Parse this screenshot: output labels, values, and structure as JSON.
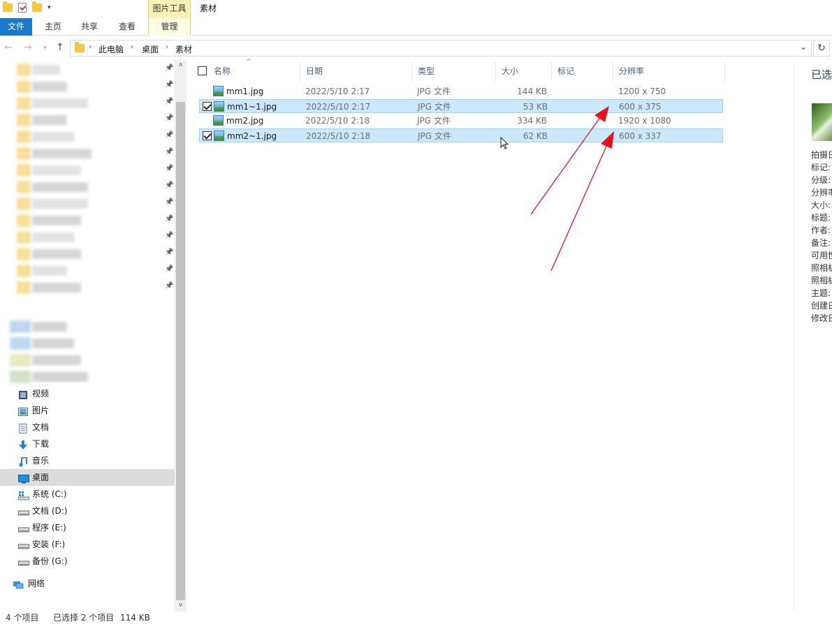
{
  "titlebar": {
    "context_group": "图片工具",
    "window_title": "素材"
  },
  "ribbon": {
    "tabs": [
      "文件",
      "主页",
      "共享",
      "查看",
      "管理"
    ]
  },
  "address": {
    "crumbs": [
      "此电脑",
      "桌面",
      "素材"
    ]
  },
  "nav": {
    "libraries": [
      {
        "label": "视频",
        "icon": "video-icon"
      },
      {
        "label": "图片",
        "icon": "picture-icon"
      },
      {
        "label": "文档",
        "icon": "document-icon"
      },
      {
        "label": "下载",
        "icon": "download-icon"
      },
      {
        "label": "音乐",
        "icon": "music-icon"
      },
      {
        "label": "桌面",
        "icon": "desktop-icon"
      }
    ],
    "drives": [
      {
        "label": "系统 (C:)",
        "icon": "windows-drive-icon"
      },
      {
        "label": "文档 (D:)",
        "icon": "drive-icon"
      },
      {
        "label": "程序 (E:)",
        "icon": "drive-icon"
      },
      {
        "label": "安装 (F:)",
        "icon": "drive-icon"
      },
      {
        "label": "备份 (G:)",
        "icon": "drive-icon"
      }
    ],
    "network": "网络"
  },
  "columns": {
    "name": "名称",
    "date": "日期",
    "type": "类型",
    "size": "大小",
    "tags": "标记",
    "resolution": "分辨率"
  },
  "files": [
    {
      "name": "mm1.jpg",
      "date": "2022/5/10 2:17",
      "type": "JPG 文件",
      "size": "144 KB",
      "resolution": "1200 x 750",
      "selected": false
    },
    {
      "name": "mm1~1.jpg",
      "date": "2022/5/10 2:17",
      "type": "JPG 文件",
      "size": "53 KB",
      "resolution": "600 x 375",
      "selected": true
    },
    {
      "name": "mm2.jpg",
      "date": "2022/5/10 2:18",
      "type": "JPG 文件",
      "size": "334 KB",
      "resolution": "1920 x 1080",
      "selected": false
    },
    {
      "name": "mm2~1.jpg",
      "date": "2022/5/10 2:18",
      "type": "JPG 文件",
      "size": "62 KB",
      "resolution": "600 x 337",
      "selected": true
    }
  ],
  "details": {
    "title": "已选",
    "labels": [
      "拍摄日",
      "标记:",
      "分级:",
      "分辨率",
      "大小:",
      "标题:",
      "作者:",
      "备注:",
      "可用性",
      "照相机",
      "照相机",
      "主题:",
      "创建日",
      "修改日"
    ]
  },
  "status": {
    "count": "4 个项目",
    "selection": "已选择 2 个项目",
    "size": "114 KB"
  },
  "colors": {
    "accent": "#1979ca",
    "selection": "#cce8ff",
    "arrow": "#e8101b"
  }
}
